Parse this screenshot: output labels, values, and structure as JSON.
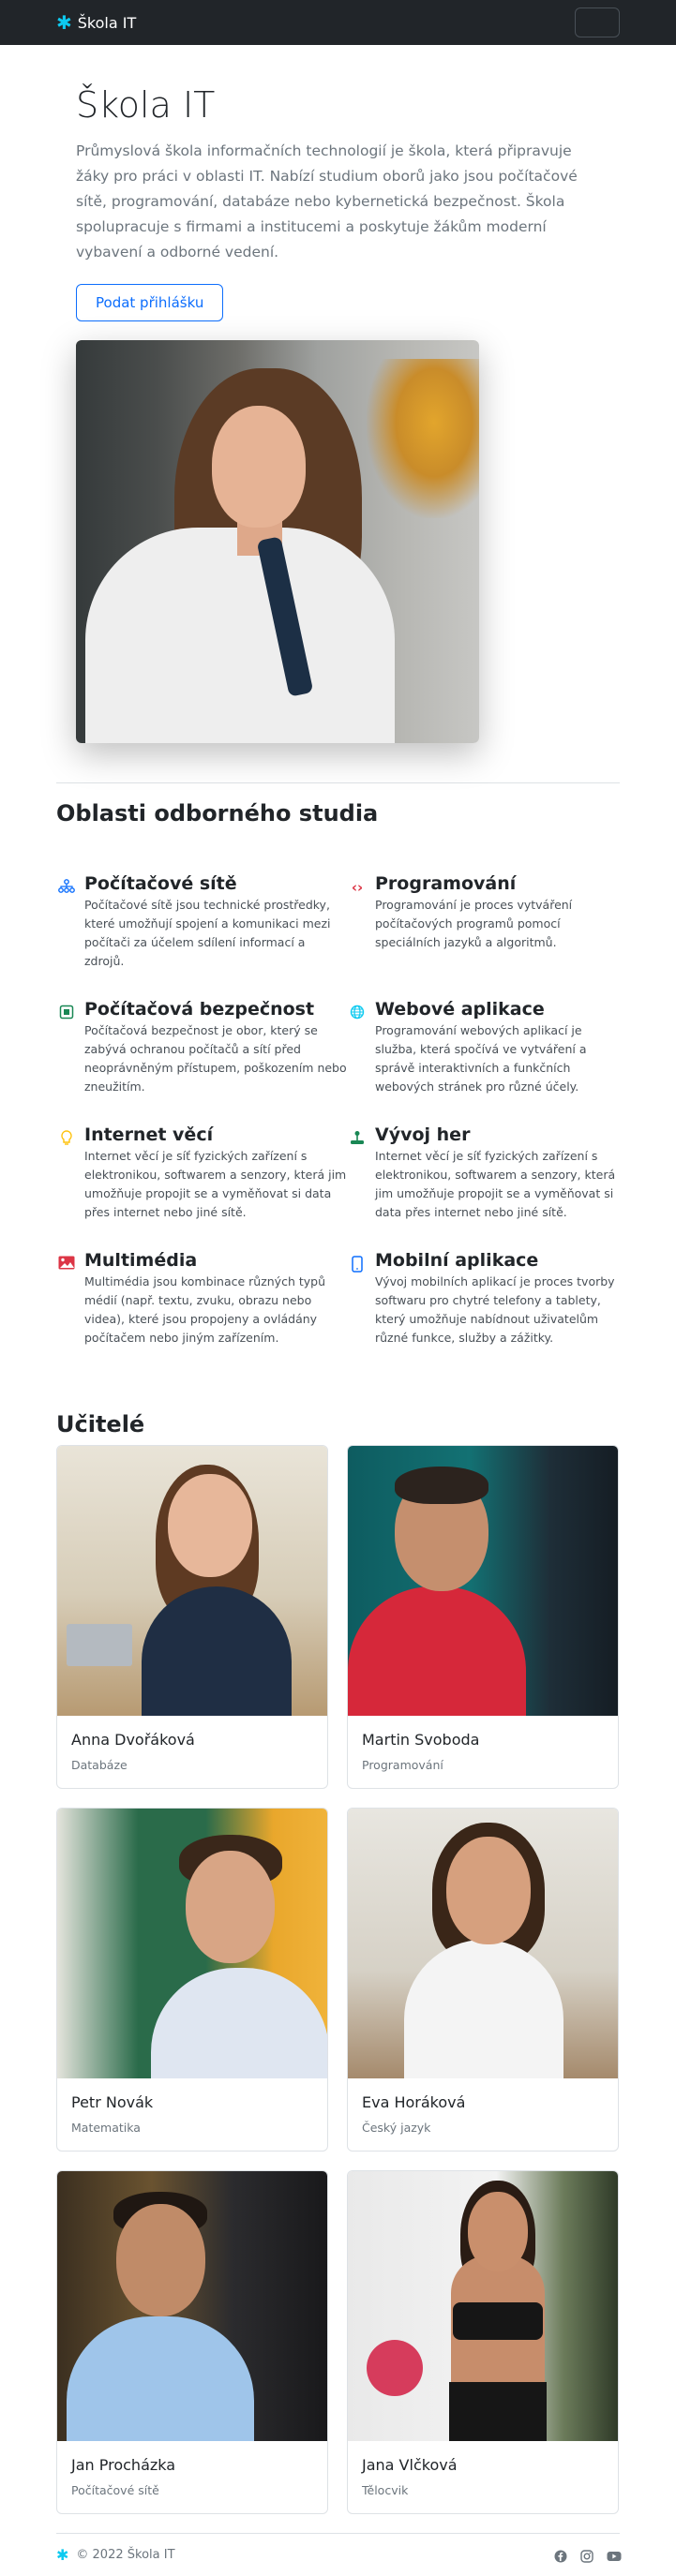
{
  "navbar": {
    "brand": "Škola IT",
    "brand_icon": "asterisk-icon",
    "accent_color": "#0dcaf0"
  },
  "hero": {
    "title": "Škola IT",
    "text": "Průmyslová škola informačních technologií je škola, která připravuje žáky pro práci v oblasti IT. Nabízí studium oborů jako jsou počítačové sítě, programování, databáze nebo kybernetická bezpečnost. Škola spolupracuje s firmami a institucemi a poskytuje žákům moderní vybavení a odborné vedení.",
    "button": "Podat přihlášku"
  },
  "fields": {
    "title": "Oblasti odborného studia",
    "items": [
      {
        "icon": "network-icon",
        "title": "Počítačové sítě",
        "text": "Počítačové sítě jsou technické prostředky, které umožňují spojení a komunikaci mezi počítači za účelem sdílení informací a zdrojů."
      },
      {
        "icon": "code-icon",
        "title": "Programování",
        "text": "Programování je proces vytváření počítačových programů pomocí speciálních jazyků a algoritmů."
      },
      {
        "icon": "shield-chip-icon",
        "title": "Počítačová bezpečnost",
        "text": "Počítačová bezpečnost je obor, který se zabývá ochranou počítačů a sítí před neoprávněným přístupem, poškozením nebo zneužitím."
      },
      {
        "icon": "globe-icon",
        "title": "Webové aplikace",
        "text": "Programování webových aplikací je služba, která spočívá ve vytváření a správě interaktivních a funkčních webových stránek pro různé účely."
      },
      {
        "icon": "lightbulb-icon",
        "title": "Internet věcí",
        "text": "Internet věcí je síť fyzických zařízení s elektronikou, softwarem a senzory, která jim umožňuje propojit se a vyměňovat si data přes internet nebo jiné sítě."
      },
      {
        "icon": "joystick-icon",
        "title": "Vývoj her",
        "text": "Internet věcí je síť fyzických zařízení s elektronikou, softwarem a senzory, která jim umožňuje propojit se a vyměňovat si data přes internet nebo jiné sítě."
      },
      {
        "icon": "image-icon",
        "title": "Multimédia",
        "text": "Multimédia jsou kombinace různých typů médií (např. textu, zvuku, obrazu nebo videa), které jsou propojeny a ovládány počítačem nebo jiným zařízením."
      },
      {
        "icon": "phone-icon",
        "title": "Mobilní aplikace",
        "text": "Vývoj mobilních aplikací je proces tvorby softwaru pro chytré telefony a tablety, který umožňuje nabídnout uživatelům různé funkce, služby a zážitky."
      }
    ]
  },
  "teachers": {
    "title": "Učitelé",
    "items": [
      {
        "name": "Anna Dvořáková",
        "subject": "Databáze"
      },
      {
        "name": "Martin Svoboda",
        "subject": "Programování"
      },
      {
        "name": "Petr Novák",
        "subject": "Matematika"
      },
      {
        "name": "Eva Horáková",
        "subject": "Český jazyk"
      },
      {
        "name": "Jan Procházka",
        "subject": "Počítačové sítě"
      },
      {
        "name": "Jana Vlčková",
        "subject": "Tělocvik"
      }
    ]
  },
  "footer": {
    "copyright": "© 2022 Škola IT",
    "socials": [
      "facebook-icon",
      "instagram-icon",
      "youtube-icon"
    ]
  }
}
